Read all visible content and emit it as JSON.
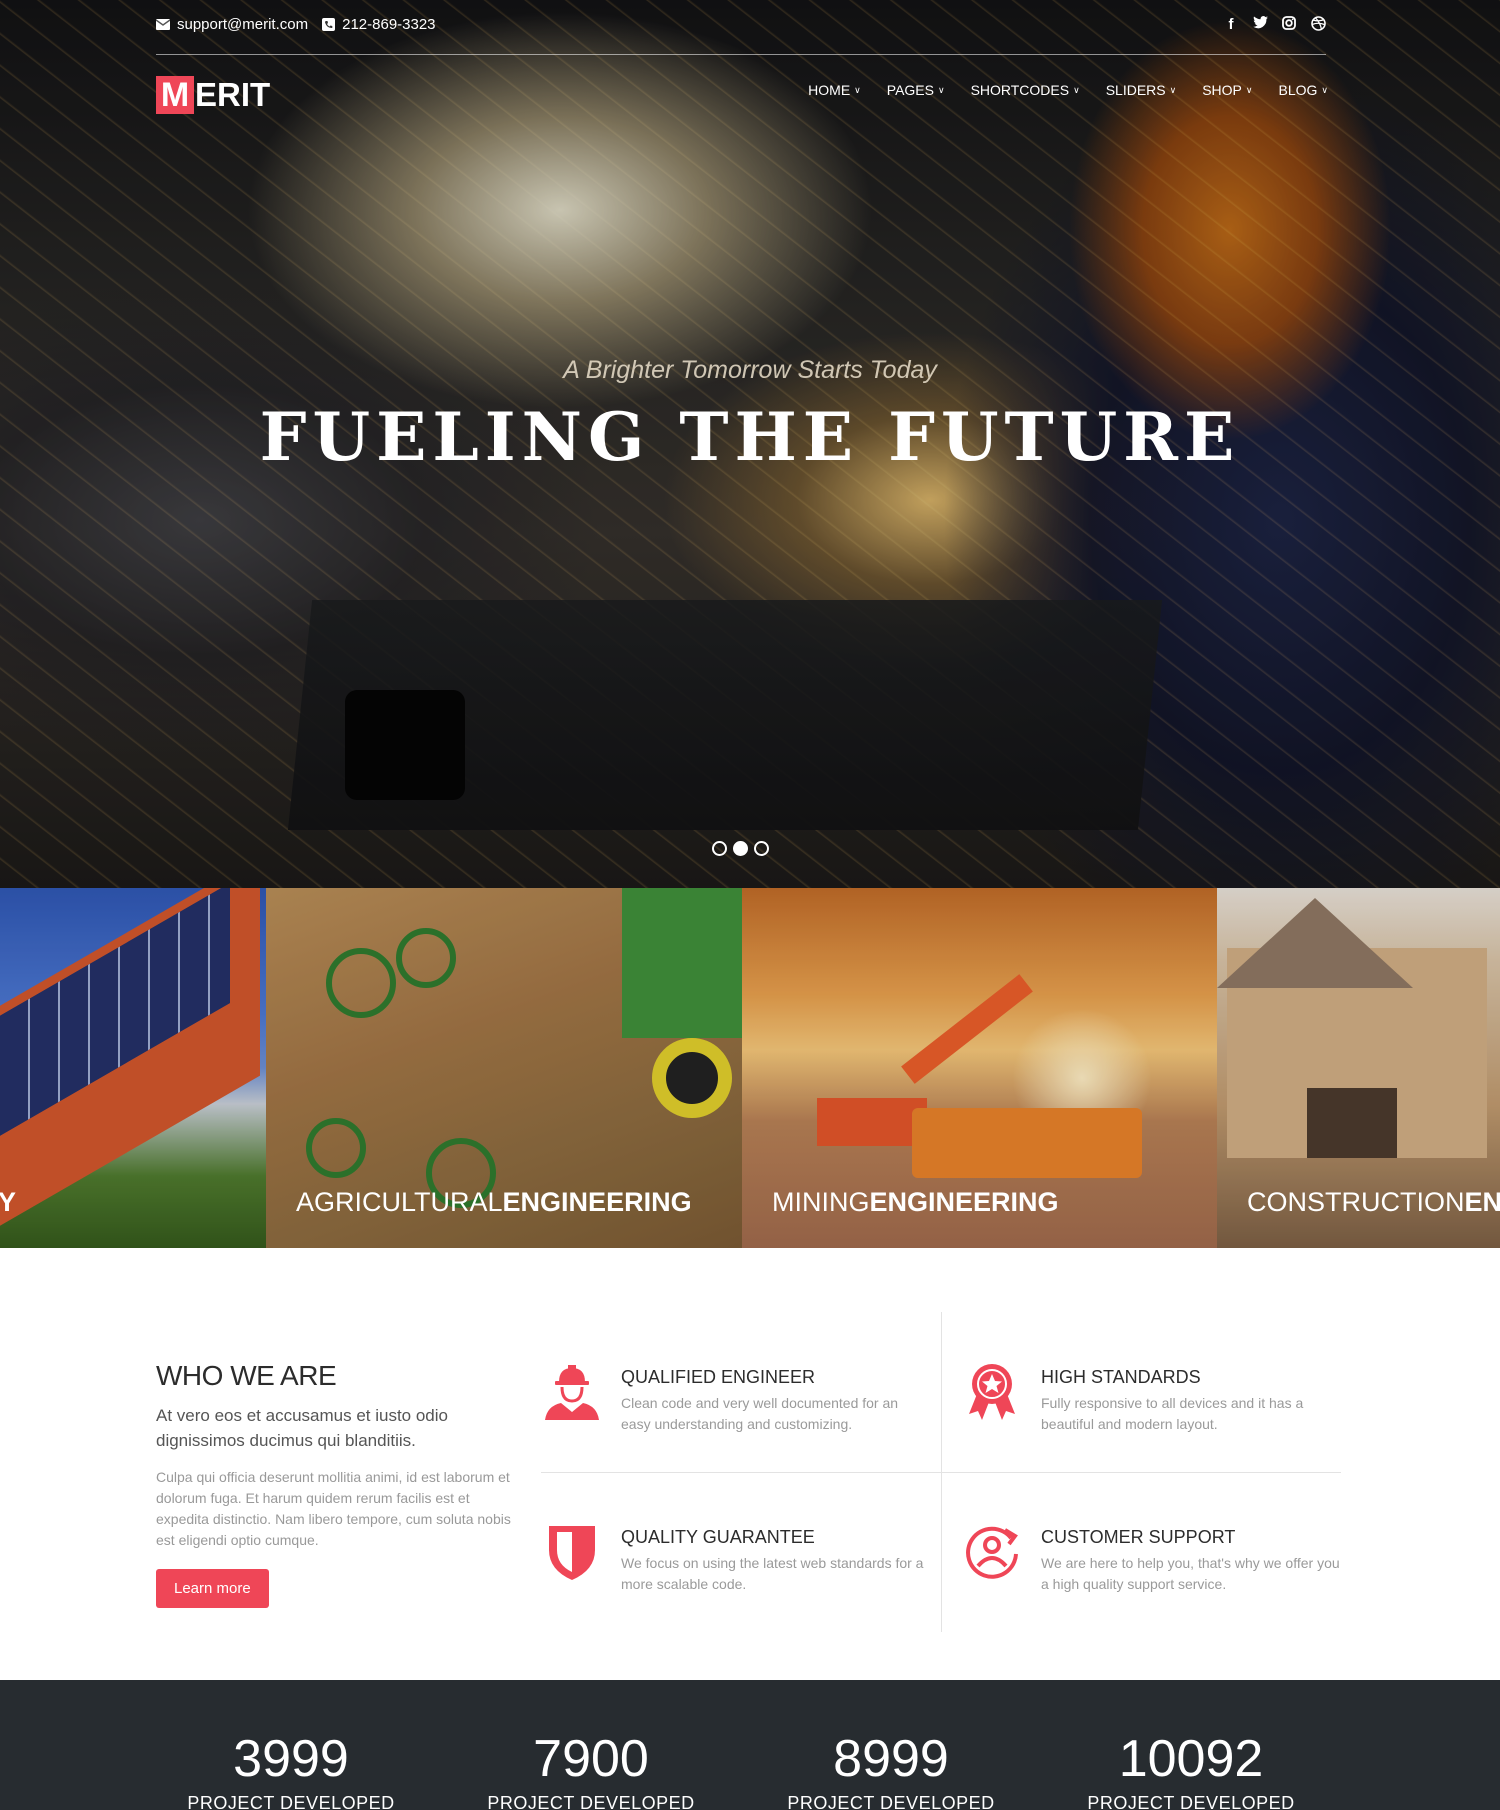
{
  "topbar": {
    "email": "support@merit.com",
    "phone": "212-869-3323",
    "social_icons": [
      "facebook-icon",
      "twitter-icon",
      "instagram-icon",
      "dribbble-icon"
    ]
  },
  "logo": {
    "initial": "M",
    "rest": "ERIT"
  },
  "nav": {
    "items": [
      {
        "label": "HOME"
      },
      {
        "label": "PAGES"
      },
      {
        "label": "SHORTCODES"
      },
      {
        "label": "SLIDERS"
      },
      {
        "label": "SHOP"
      },
      {
        "label": "BLOG"
      }
    ]
  },
  "hero": {
    "subtitle": "A Brighter Tomorrow Starts Today",
    "title": "FUELING THE FUTURE",
    "slide_count": 3,
    "active_slide": 2
  },
  "categories": [
    {
      "light": "",
      "bold": "Y"
    },
    {
      "light": "AGRICULTURAL",
      "bold": "ENGINEERING"
    },
    {
      "light": "MINING",
      "bold": "ENGINEERING"
    },
    {
      "light": "CONSTRUCTION",
      "bold": "EN"
    }
  ],
  "who": {
    "heading": "WHO WE ARE",
    "lead": "At vero eos et accusamus et iusto odio dignissimos ducimus qui blanditiis.",
    "body": "Culpa qui officia deserunt mollitia animi, id est laborum et dolorum fuga. Et harum quidem rerum facilis est et expedita distinctio. Nam libero tempore, cum soluta nobis est eligendi optio cumque.",
    "button": "Learn more"
  },
  "features": [
    {
      "icon": "engineer-icon",
      "title": "QUALIFIED ENGINEER",
      "desc": "Clean code and very well documented for an easy understanding and customizing."
    },
    {
      "icon": "award-badge-icon",
      "title": "HIGH STANDARDS",
      "desc": "Fully responsive to all devices and it has a beautiful and modern layout."
    },
    {
      "icon": "shield-icon",
      "title": "QUALITY GUARANTEE",
      "desc": "We focus on using the latest web standards for a more scalable code."
    },
    {
      "icon": "customer-support-icon",
      "title": "CUSTOMER SUPPORT",
      "desc": "We are here to help you, that's why we offer you a high quality support service."
    }
  ],
  "stats": [
    {
      "value": "3999",
      "label": "PROJECT DEVELOPED"
    },
    {
      "value": "7900",
      "label": "PROJECT DEVELOPED"
    },
    {
      "value": "8999",
      "label": "PROJECT DEVELOPED"
    },
    {
      "value": "10092",
      "label": "PROJECT DEVELOPED"
    }
  ],
  "colors": {
    "accent": "#ef4657",
    "dark_band": "#272c30"
  }
}
